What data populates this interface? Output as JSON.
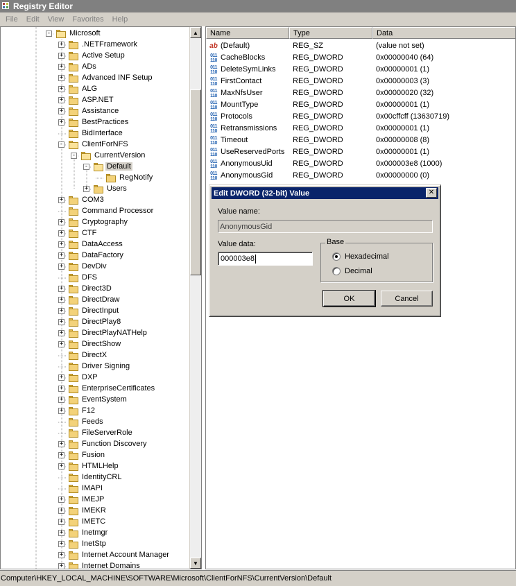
{
  "window": {
    "title": "Registry Editor"
  },
  "menu": [
    "File",
    "Edit",
    "View",
    "Favorites",
    "Help"
  ],
  "tree": [
    {
      "label": "Microsoft",
      "depth": 0,
      "expander": "-",
      "selected": false
    },
    {
      "label": ".NETFramework",
      "depth": 1,
      "expander": "+",
      "selected": false
    },
    {
      "label": "Active Setup",
      "depth": 1,
      "expander": "+",
      "selected": false
    },
    {
      "label": "ADs",
      "depth": 1,
      "expander": "+",
      "selected": false
    },
    {
      "label": "Advanced INF Setup",
      "depth": 1,
      "expander": "+",
      "selected": false
    },
    {
      "label": "ALG",
      "depth": 1,
      "expander": "+",
      "selected": false
    },
    {
      "label": "ASP.NET",
      "depth": 1,
      "expander": "+",
      "selected": false
    },
    {
      "label": "Assistance",
      "depth": 1,
      "expander": "+",
      "selected": false
    },
    {
      "label": "BestPractices",
      "depth": 1,
      "expander": "+",
      "selected": false
    },
    {
      "label": "BidInterface",
      "depth": 1,
      "expander": "",
      "selected": false
    },
    {
      "label": "ClientForNFS",
      "depth": 1,
      "expander": "-",
      "selected": false
    },
    {
      "label": "CurrentVersion",
      "depth": 2,
      "expander": "-",
      "selected": false
    },
    {
      "label": "Default",
      "depth": 3,
      "expander": "-",
      "selected": true
    },
    {
      "label": "RegNotify",
      "depth": 4,
      "expander": "",
      "selected": false
    },
    {
      "label": "Users",
      "depth": 3,
      "expander": "+",
      "selected": false
    },
    {
      "label": "COM3",
      "depth": 1,
      "expander": "+",
      "selected": false
    },
    {
      "label": "Command Processor",
      "depth": 1,
      "expander": "",
      "selected": false
    },
    {
      "label": "Cryptography",
      "depth": 1,
      "expander": "+",
      "selected": false
    },
    {
      "label": "CTF",
      "depth": 1,
      "expander": "+",
      "selected": false
    },
    {
      "label": "DataAccess",
      "depth": 1,
      "expander": "+",
      "selected": false
    },
    {
      "label": "DataFactory",
      "depth": 1,
      "expander": "+",
      "selected": false
    },
    {
      "label": "DevDiv",
      "depth": 1,
      "expander": "+",
      "selected": false
    },
    {
      "label": "DFS",
      "depth": 1,
      "expander": "",
      "selected": false
    },
    {
      "label": "Direct3D",
      "depth": 1,
      "expander": "+",
      "selected": false
    },
    {
      "label": "DirectDraw",
      "depth": 1,
      "expander": "+",
      "selected": false
    },
    {
      "label": "DirectInput",
      "depth": 1,
      "expander": "+",
      "selected": false
    },
    {
      "label": "DirectPlay8",
      "depth": 1,
      "expander": "+",
      "selected": false
    },
    {
      "label": "DirectPlayNATHelp",
      "depth": 1,
      "expander": "+",
      "selected": false
    },
    {
      "label": "DirectShow",
      "depth": 1,
      "expander": "+",
      "selected": false
    },
    {
      "label": "DirectX",
      "depth": 1,
      "expander": "",
      "selected": false
    },
    {
      "label": "Driver Signing",
      "depth": 1,
      "expander": "",
      "selected": false
    },
    {
      "label": "DXP",
      "depth": 1,
      "expander": "+",
      "selected": false
    },
    {
      "label": "EnterpriseCertificates",
      "depth": 1,
      "expander": "+",
      "selected": false
    },
    {
      "label": "EventSystem",
      "depth": 1,
      "expander": "+",
      "selected": false
    },
    {
      "label": "F12",
      "depth": 1,
      "expander": "+",
      "selected": false
    },
    {
      "label": "Feeds",
      "depth": 1,
      "expander": "",
      "selected": false
    },
    {
      "label": "FileServerRole",
      "depth": 1,
      "expander": "",
      "selected": false
    },
    {
      "label": "Function Discovery",
      "depth": 1,
      "expander": "+",
      "selected": false
    },
    {
      "label": "Fusion",
      "depth": 1,
      "expander": "+",
      "selected": false
    },
    {
      "label": "HTMLHelp",
      "depth": 1,
      "expander": "+",
      "selected": false
    },
    {
      "label": "IdentityCRL",
      "depth": 1,
      "expander": "",
      "selected": false
    },
    {
      "label": "IMAPI",
      "depth": 1,
      "expander": "",
      "selected": false
    },
    {
      "label": "IMEJP",
      "depth": 1,
      "expander": "+",
      "selected": false
    },
    {
      "label": "IMEKR",
      "depth": 1,
      "expander": "+",
      "selected": false
    },
    {
      "label": "IMETC",
      "depth": 1,
      "expander": "+",
      "selected": false
    },
    {
      "label": "Inetmgr",
      "depth": 1,
      "expander": "+",
      "selected": false
    },
    {
      "label": "InetStp",
      "depth": 1,
      "expander": "+",
      "selected": false
    },
    {
      "label": "Internet Account Manager",
      "depth": 1,
      "expander": "+",
      "selected": false
    },
    {
      "label": "Internet Domains",
      "depth": 1,
      "expander": "+",
      "selected": false
    }
  ],
  "list": {
    "columns": [
      "Name",
      "Type",
      "Data"
    ],
    "rows": [
      {
        "icon": "string-value-icon",
        "name": "(Default)",
        "type": "REG_SZ",
        "data": "(value not set)"
      },
      {
        "icon": "binary-value-icon",
        "name": "CacheBlocks",
        "type": "REG_DWORD",
        "data": "0x00000040 (64)"
      },
      {
        "icon": "binary-value-icon",
        "name": "DeleteSymLinks",
        "type": "REG_DWORD",
        "data": "0x00000001 (1)"
      },
      {
        "icon": "binary-value-icon",
        "name": "FirstContact",
        "type": "REG_DWORD",
        "data": "0x00000003 (3)"
      },
      {
        "icon": "binary-value-icon",
        "name": "MaxNfsUser",
        "type": "REG_DWORD",
        "data": "0x00000020 (32)"
      },
      {
        "icon": "binary-value-icon",
        "name": "MountType",
        "type": "REG_DWORD",
        "data": "0x00000001 (1)"
      },
      {
        "icon": "binary-value-icon",
        "name": "Protocols",
        "type": "REG_DWORD",
        "data": "0x00cffcff (13630719)"
      },
      {
        "icon": "binary-value-icon",
        "name": "Retransmissions",
        "type": "REG_DWORD",
        "data": "0x00000001 (1)"
      },
      {
        "icon": "binary-value-icon",
        "name": "Timeout",
        "type": "REG_DWORD",
        "data": "0x00000008 (8)"
      },
      {
        "icon": "binary-value-icon",
        "name": "UseReservedPorts",
        "type": "REG_DWORD",
        "data": "0x00000001 (1)"
      },
      {
        "icon": "binary-value-icon",
        "name": "AnonymousUid",
        "type": "REG_DWORD",
        "data": "0x000003e8 (1000)"
      },
      {
        "icon": "binary-value-icon",
        "name": "AnonymousGid",
        "type": "REG_DWORD",
        "data": "0x00000000 (0)"
      }
    ]
  },
  "status": {
    "path": "Computer\\HKEY_LOCAL_MACHINE\\SOFTWARE\\Microsoft\\ClientForNFS\\CurrentVersion\\Default"
  },
  "dialog": {
    "title": "Edit DWORD (32-bit) Value",
    "close": "✕",
    "value_name_label": "Value name:",
    "value_name": "AnonymousGid",
    "value_data_label": "Value data:",
    "value_data": "000003e8",
    "base_label": "Base",
    "hex_label": "Hexadecimal",
    "dec_label": "Decimal",
    "selected_base": "hexadecimal",
    "ok": "OK",
    "cancel": "Cancel"
  }
}
